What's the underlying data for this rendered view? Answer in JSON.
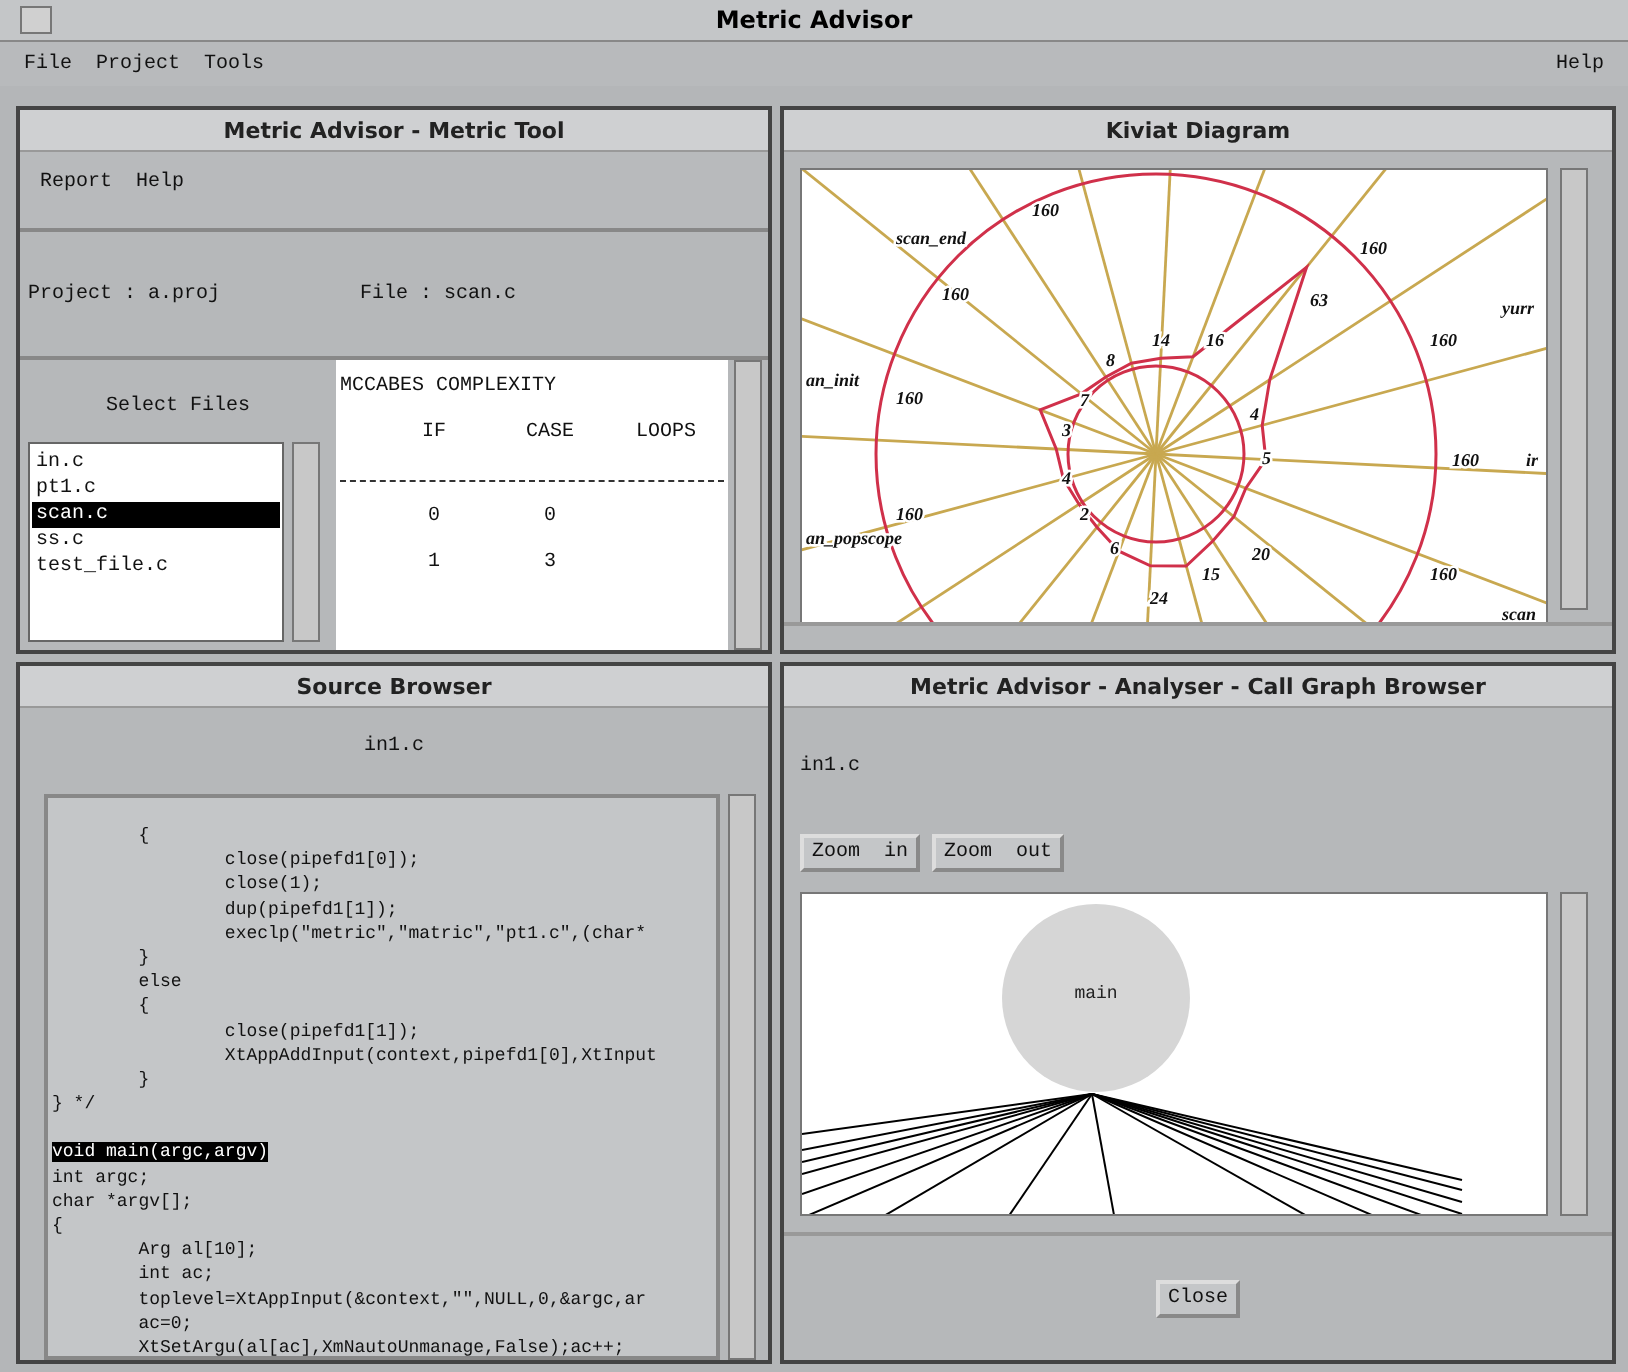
{
  "window": {
    "title": "Metric Advisor"
  },
  "menu": [
    {
      "label": "File"
    },
    {
      "label": "Project"
    },
    {
      "label": "Tools"
    }
  ],
  "help_menu": {
    "label": "Help"
  },
  "metric_tool": {
    "title": "Metric Advisor - Metric Tool",
    "menu": [
      {
        "label": "Report"
      },
      {
        "label": "Help"
      }
    ],
    "project_label": "Project : a.proj",
    "file_label": "File : scan.c",
    "select_title": "Select Files",
    "files": [
      {
        "name": "in.c",
        "selected": false
      },
      {
        "name": "pt1.c",
        "selected": false
      },
      {
        "name": "scan.c",
        "selected": true
      },
      {
        "name": "ss.c",
        "selected": false
      },
      {
        "name": "test_file.c",
        "selected": false
      }
    ],
    "table": {
      "heading": "MCCABES COMPLEXITY",
      "columns": [
        "IF",
        "CASE",
        "LOOPS"
      ],
      "rows": [
        [
          "0",
          "0"
        ],
        [
          "1",
          "3"
        ]
      ]
    }
  },
  "kiviat": {
    "title": "Kiviat Diagram",
    "labels": [
      "160",
      "scan_end",
      "160",
      "160",
      "63",
      "yurr",
      "14",
      "16",
      "8",
      "160",
      "an_init",
      "160",
      "7",
      "3",
      "4",
      "5",
      "160",
      "ir",
      "4",
      "160",
      "an_popscope",
      "2",
      "6",
      "20",
      "15",
      "24",
      "160",
      "scan"
    ]
  },
  "source_browser": {
    "title": "Source Browser",
    "file": "in1.c",
    "blocks": [
      {
        "lines": [
          {
            "text": "        {",
            "selected": false
          },
          {
            "text": "                close(pipefd1[0]);",
            "selected": false
          },
          {
            "text": "                close(1);",
            "selected": false
          },
          {
            "text": "                dup(pipefd1[1]);",
            "selected": false
          },
          {
            "text": "                execlp(\"metric\",\"matric\",\"pt1.c\",(char*",
            "selected": false
          },
          {
            "text": "        }",
            "selected": false
          },
          {
            "text": "        else",
            "selected": false
          },
          {
            "text": "        {",
            "selected": false
          },
          {
            "text": "                close(pipefd1[1]);",
            "selected": false
          },
          {
            "text": "                XtAppAddInput(context,pipefd1[0],XtInput",
            "selected": false
          },
          {
            "text": "        }",
            "selected": false
          },
          {
            "text": "} */",
            "selected": false
          }
        ]
      },
      {
        "lines": [
          {
            "text": "void main(argc,argv)",
            "selected": true
          },
          {
            "text": "int argc;",
            "selected": false
          },
          {
            "text": "char *argv[];",
            "selected": false
          },
          {
            "text": "{",
            "selected": false
          },
          {
            "text": "        Arg al[10];",
            "selected": false
          },
          {
            "text": "        int ac;",
            "selected": false
          },
          {
            "text": "        toplevel=XtAppInput(&context,\"\",NULL,0,&argc,ar",
            "selected": false
          },
          {
            "text": "        ac=0;",
            "selected": false
          },
          {
            "text": "        XtSetArgu(al[ac],XmNautoUnmanage,False);ac++;",
            "selected": false
          }
        ]
      }
    ]
  },
  "call_graph": {
    "title": "Metric Advisor - Analyser - Call Graph Browser",
    "file": "in1.c",
    "buttons": [
      {
        "label": "Zoom  in"
      },
      {
        "label": "Zoom  out"
      }
    ],
    "node": "main",
    "close": "Close"
  }
}
